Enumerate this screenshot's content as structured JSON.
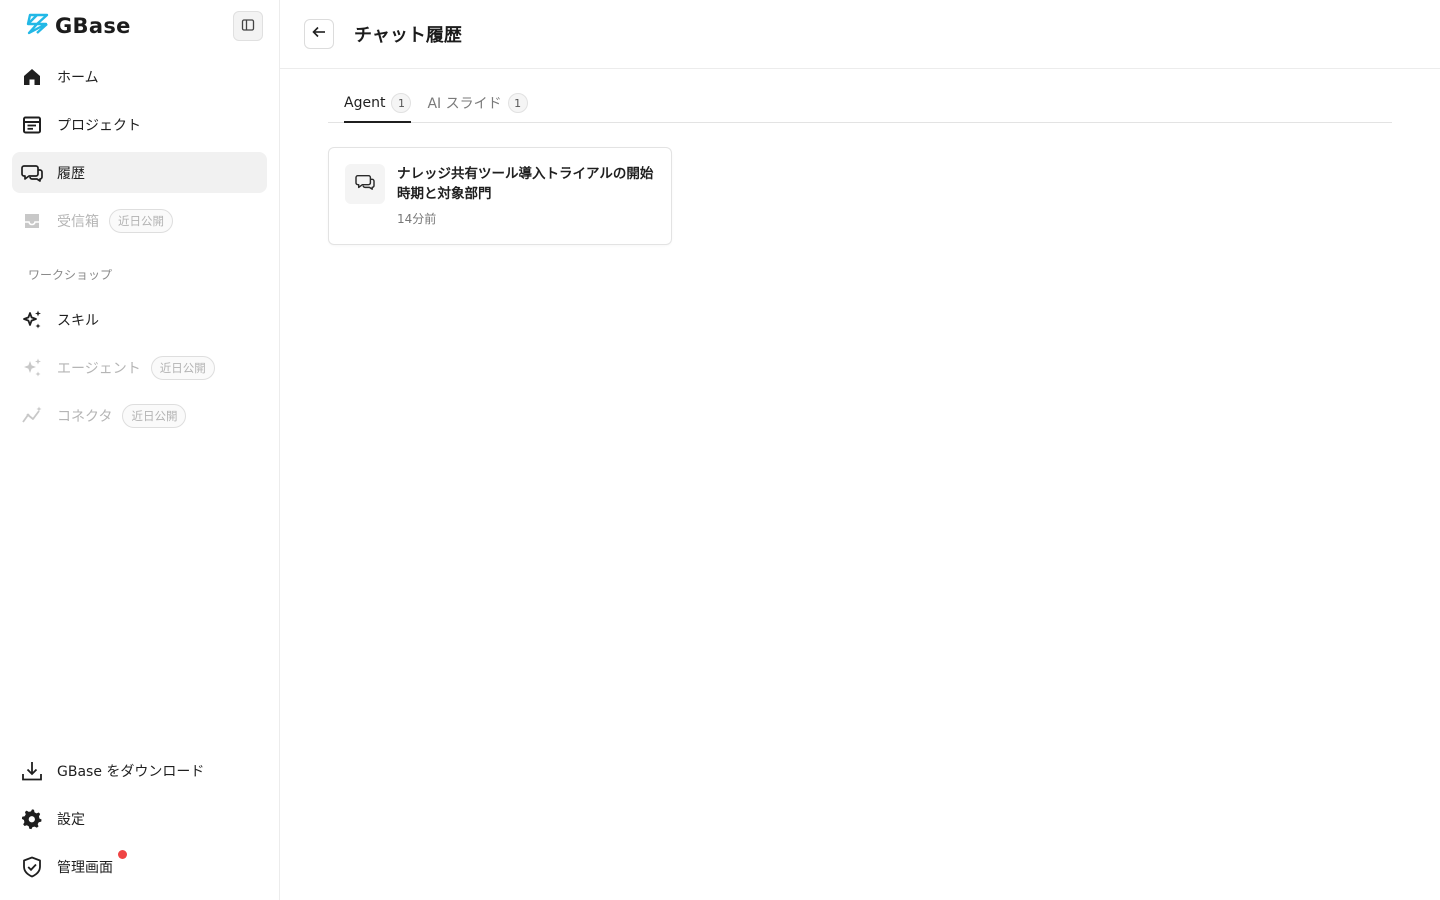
{
  "brand": {
    "name": "GBase",
    "accent": "#22b8e6"
  },
  "sidebar": {
    "items": [
      {
        "label": "ホーム",
        "icon": "home-icon"
      },
      {
        "label": "プロジェクト",
        "icon": "project-icon"
      },
      {
        "label": "履歴",
        "icon": "chat-history-icon",
        "active": true
      },
      {
        "label": "受信箱",
        "icon": "inbox-icon",
        "disabled": true,
        "badge": "近日公開"
      }
    ],
    "section_label": "ワークショップ",
    "workshop_items": [
      {
        "label": "スキル",
        "icon": "sparkle-icon"
      },
      {
        "label": "エージェント",
        "icon": "sparkle-icon",
        "disabled": true,
        "badge": "近日公開"
      },
      {
        "label": "コネクタ",
        "icon": "connector-icon",
        "disabled": true,
        "badge": "近日公開"
      }
    ],
    "bottom_items": [
      {
        "label": "GBase をダウンロード",
        "icon": "download-icon"
      },
      {
        "label": "設定",
        "icon": "gear-icon"
      },
      {
        "label": "管理画面",
        "icon": "shield-icon",
        "notification_color": "#ef4444"
      }
    ]
  },
  "header": {
    "title": "チャット履歴"
  },
  "tabs": [
    {
      "label": "Agent",
      "count": "1",
      "active": true
    },
    {
      "label": "AI スライド",
      "count": "1",
      "active": false
    }
  ],
  "cards": [
    {
      "title": "ナレッジ共有ツール導入トライアルの開始時期と対象部門",
      "time": "14分前"
    }
  ]
}
